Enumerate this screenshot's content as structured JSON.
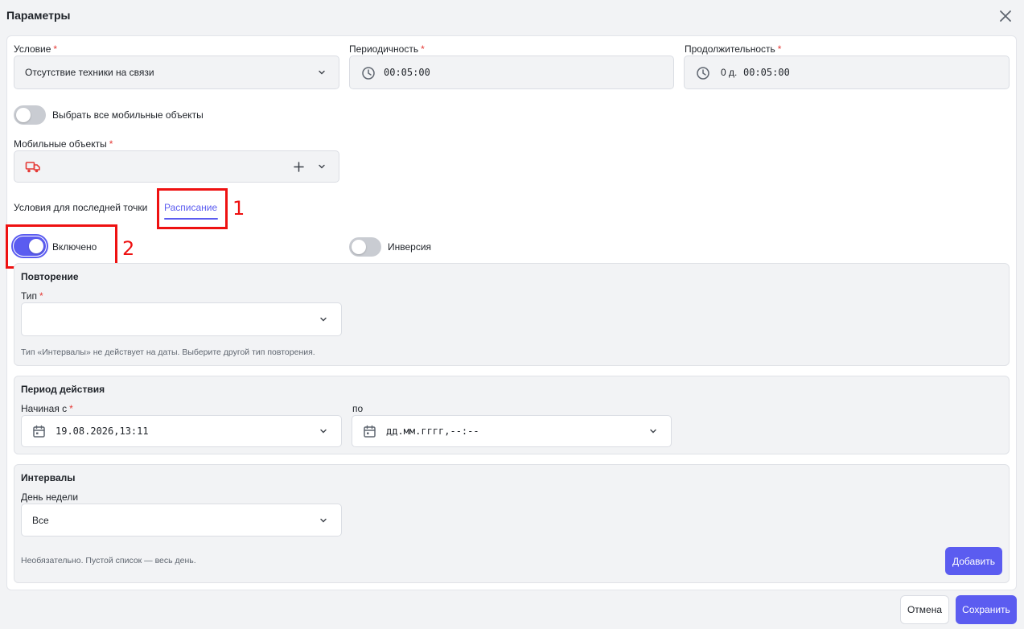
{
  "dialog": {
    "title": "Параметры"
  },
  "condition": {
    "label": "Условие",
    "value": "Отсутствие техники на связи"
  },
  "periodicity": {
    "label": "Периодичность",
    "value": "00:05:00"
  },
  "duration": {
    "label": "Продолжительность",
    "days": "0 д.",
    "value": "00:05:00"
  },
  "select_all": {
    "label": "Выбрать все мобильные объекты",
    "on": false
  },
  "mobile_objects": {
    "label": "Мобильные объекты"
  },
  "tabs": {
    "last_point": "Условия для последней точки",
    "schedule": "Расписание"
  },
  "enabled": {
    "label": "Включено",
    "on": true
  },
  "inversion": {
    "label": "Инверсия",
    "on": false
  },
  "repeat": {
    "title": "Повторение",
    "type_label": "Тип",
    "type_value": "",
    "hint": "Тип «Интервалы» не действует на даты. Выберите другой тип повторения."
  },
  "period": {
    "title": "Период действия",
    "start_label": "Начиная с",
    "start_value": "19.08.2026,13:11",
    "end_label": "по",
    "end_placeholder": "дд.мм.гггг,--:--"
  },
  "intervals": {
    "title": "Интервалы",
    "weekday_label": "День недели",
    "weekday_value": "Все",
    "hint": "Необязательно. Пустой список — весь день.",
    "add_button": "Добавить"
  },
  "footer": {
    "cancel": "Отмена",
    "save": "Сохранить"
  },
  "annotations": {
    "n1": "1",
    "n2": "2"
  },
  "colors": {
    "accent": "#5b5cf0",
    "required": "#e53935",
    "annotation": "#ee1111"
  }
}
